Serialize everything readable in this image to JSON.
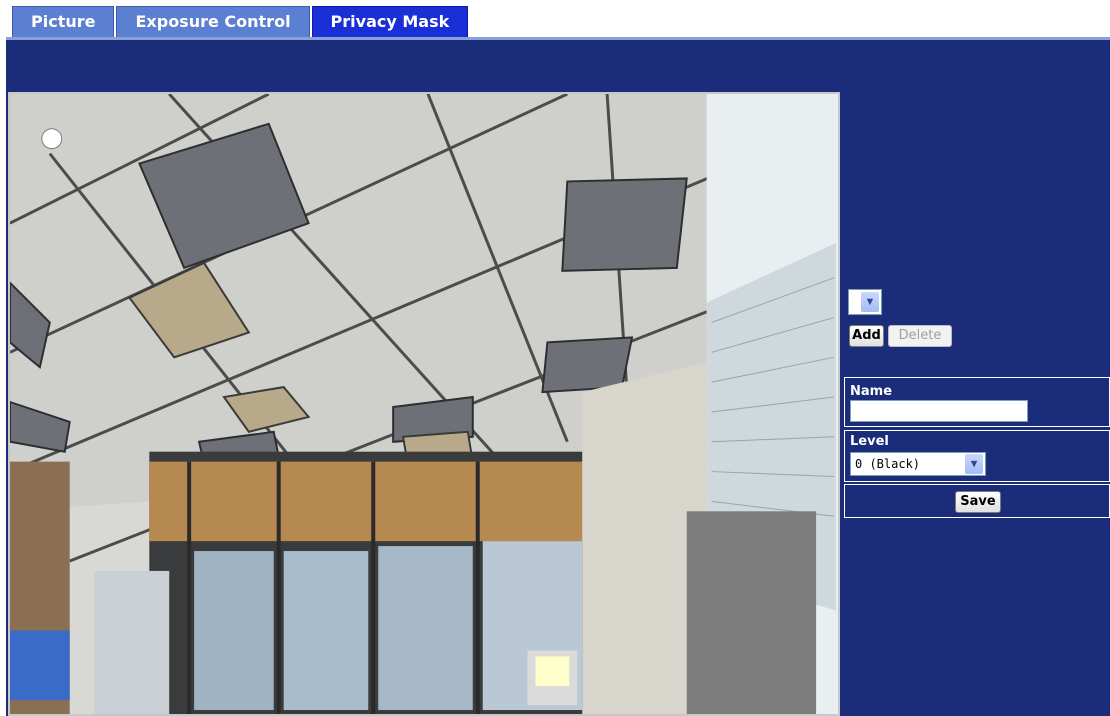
{
  "tabs": [
    {
      "label": "Picture",
      "active": false
    },
    {
      "label": "Exposure Control",
      "active": false
    },
    {
      "label": "Privacy Mask",
      "active": true
    }
  ],
  "mask_list": {
    "selected": ""
  },
  "buttons": {
    "add": "Add",
    "delete": "Delete",
    "save": "Save"
  },
  "form": {
    "name_label": "Name",
    "name_value": "",
    "level_label": "Level",
    "level_value": "0 (Black)"
  },
  "colors": {
    "panel": "#1b2c7a",
    "tab": "#5b7fd1",
    "active_tab": "#1b2fd6"
  },
  "video": {
    "description_icon": "camera-live-view"
  }
}
